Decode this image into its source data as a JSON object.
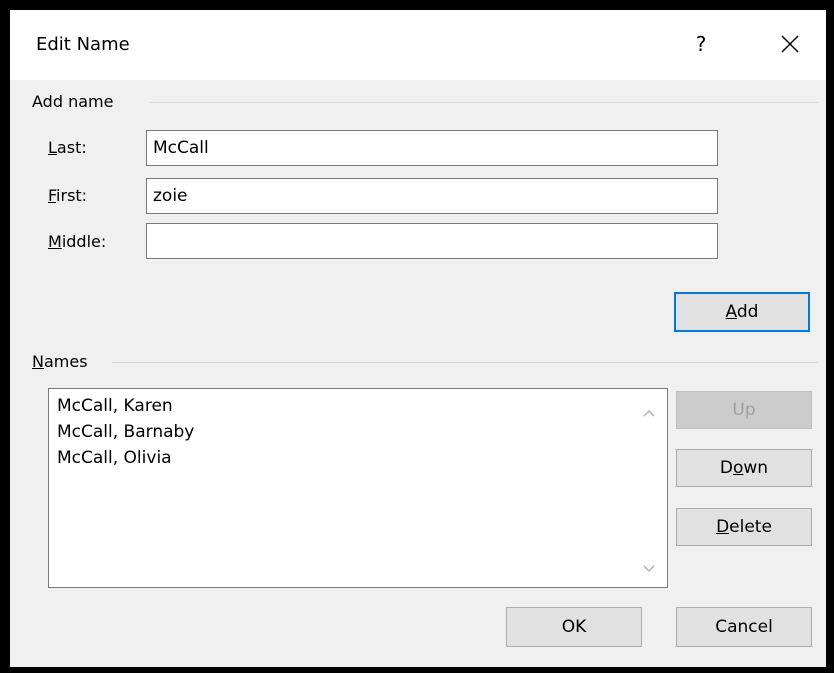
{
  "dialog": {
    "title": "Edit Name",
    "help_label": "?",
    "close_icon": "close-icon"
  },
  "add_name": {
    "group_label": "Add name",
    "last_label_accel": "L",
    "last_label_rest": "ast:",
    "last_value": "McCall",
    "first_label_accel": "F",
    "first_label_rest": "irst:",
    "first_value": "zoie",
    "middle_label_accel": "M",
    "middle_label_rest": "iddle:",
    "middle_value": "",
    "add_accel": "A",
    "add_rest": "dd"
  },
  "names": {
    "group_label_accel": "N",
    "group_label_rest": "ames",
    "items": [
      "McCall, Karen",
      "McCall, Barnaby",
      "McCall, Olivia"
    ],
    "up_label": "Up",
    "down_pre": "D",
    "down_accel": "o",
    "down_post": "wn",
    "delete_accel": "D",
    "delete_rest": "elete"
  },
  "footer": {
    "ok_label": "OK",
    "cancel_label": "Cancel"
  },
  "colors": {
    "default_button_border": "#0078d7",
    "dialog_background": "#f0f0f0"
  }
}
